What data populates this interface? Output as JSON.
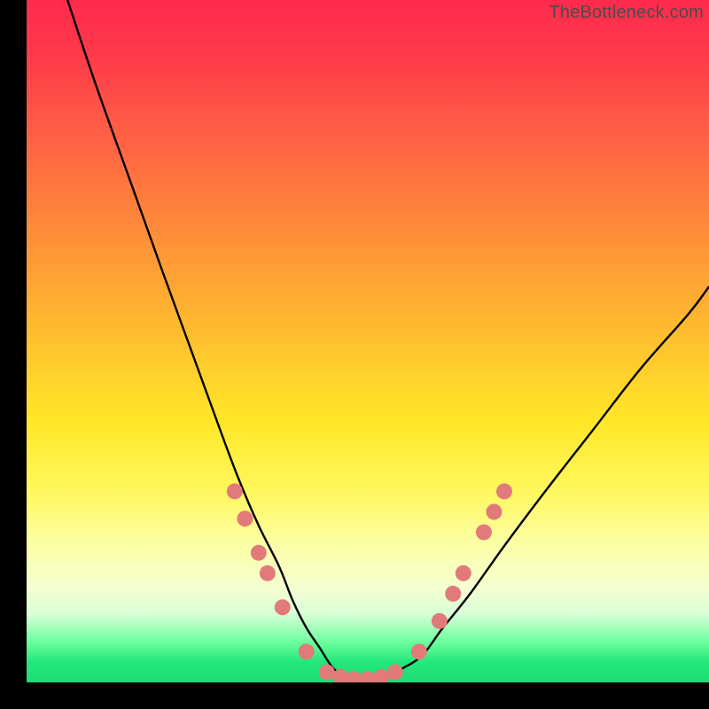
{
  "watermark": "TheBottleneck.com",
  "chart_data": {
    "type": "line",
    "title": "",
    "xlabel": "",
    "ylabel": "",
    "xlim": [
      0,
      100
    ],
    "ylim": [
      0,
      100
    ],
    "grid": false,
    "legend": false,
    "series": [
      {
        "name": "bottleneck-curve",
        "x": [
          6,
          10,
          15,
          20,
          24,
          28,
          31,
          34,
          37,
          39,
          41,
          43,
          45,
          47,
          49,
          51,
          53,
          55,
          58,
          61,
          65,
          70,
          76,
          83,
          90,
          97,
          100
        ],
        "values": [
          100,
          88,
          74,
          60,
          49,
          38,
          30,
          23,
          17,
          12,
          8,
          5,
          2,
          1,
          0.5,
          0.5,
          1,
          2,
          4,
          8,
          13,
          20,
          28,
          37,
          46,
          54,
          58
        ]
      }
    ],
    "markers": [
      {
        "x": 30.5,
        "y": 28
      },
      {
        "x": 32.0,
        "y": 24
      },
      {
        "x": 34.0,
        "y": 19
      },
      {
        "x": 35.3,
        "y": 16
      },
      {
        "x": 37.5,
        "y": 11
      },
      {
        "x": 41.0,
        "y": 4.5
      },
      {
        "x": 44.0,
        "y": 1.5
      },
      {
        "x": 46.0,
        "y": 0.8
      },
      {
        "x": 48.0,
        "y": 0.5
      },
      {
        "x": 50.0,
        "y": 0.5
      },
      {
        "x": 52.0,
        "y": 0.8
      },
      {
        "x": 54.0,
        "y": 1.5
      },
      {
        "x": 57.5,
        "y": 4.5
      },
      {
        "x": 60.5,
        "y": 9
      },
      {
        "x": 62.5,
        "y": 13
      },
      {
        "x": 64.0,
        "y": 16
      },
      {
        "x": 67.0,
        "y": 22
      },
      {
        "x": 68.5,
        "y": 25
      },
      {
        "x": 70.0,
        "y": 28
      }
    ],
    "marker_style": {
      "color": "#e27a7a",
      "radius_px": 9
    }
  }
}
